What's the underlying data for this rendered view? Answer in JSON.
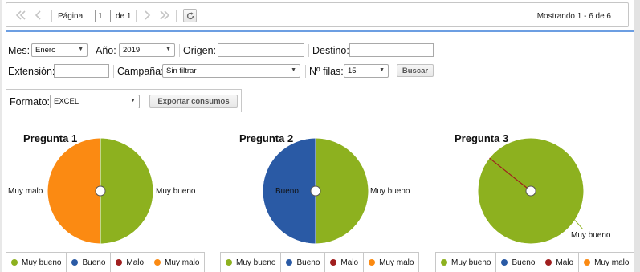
{
  "toolbar": {
    "page_label": "Página",
    "page_value": "1",
    "of_label": "de 1",
    "showing": "Mostrando 1 - 6 de 6"
  },
  "filters": {
    "mes_label": "Mes:",
    "mes_value": "Enero",
    "anio_label": "Año:",
    "anio_value": "2019",
    "origen_label": "Origen:",
    "origen_value": "",
    "destino_label": "Destino:",
    "destino_value": "",
    "extension_label": "Extensión:",
    "extension_value": "",
    "campana_label": "Campaña:",
    "campana_value": "Sin filtrar",
    "nfilas_label": "Nº filas:",
    "nfilas_value": "15",
    "buscar_label": "Buscar"
  },
  "export": {
    "formato_label": "Formato:",
    "formato_value": "EXCEL",
    "export_label": "Exportar consumos"
  },
  "colors": {
    "muy_bueno": "#8db11f",
    "bueno": "#2a5aa5",
    "malo": "#a01f1f",
    "muy_malo": "#fb8a12"
  },
  "legend": [
    {
      "label": "Muy bueno",
      "color": "#8db11f"
    },
    {
      "label": "Bueno",
      "color": "#2a5aa5"
    },
    {
      "label": "Malo",
      "color": "#a01f1f"
    },
    {
      "label": "Muy malo",
      "color": "#fb8a12"
    }
  ],
  "chart_data": [
    {
      "type": "pie",
      "title": "Pregunta 1",
      "categories": [
        "Muy bueno",
        "Bueno",
        "Malo",
        "Muy malo"
      ],
      "values": [
        1,
        0,
        0,
        1
      ],
      "visible_labels": [
        "Muy malo",
        "Muy bueno"
      ]
    },
    {
      "type": "pie",
      "title": "Pregunta 2",
      "categories": [
        "Muy bueno",
        "Bueno",
        "Malo",
        "Muy malo"
      ],
      "values": [
        1,
        1,
        0,
        0
      ],
      "visible_labels": [
        "Bueno",
        "Muy bueno"
      ]
    },
    {
      "type": "pie",
      "title": "Pregunta 3",
      "categories": [
        "Muy bueno",
        "Bueno",
        "Malo",
        "Muy malo"
      ],
      "values": [
        2,
        0,
        0,
        0
      ],
      "visible_labels": [
        "Muy bueno"
      ]
    }
  ]
}
